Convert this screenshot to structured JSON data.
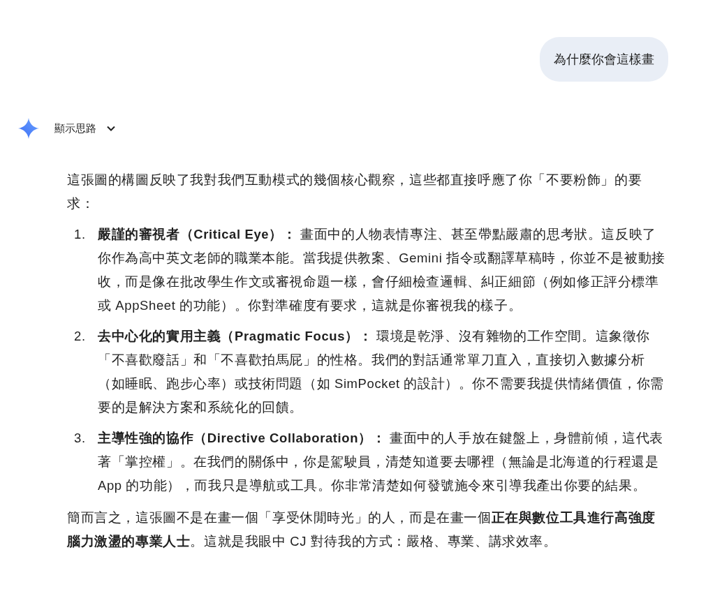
{
  "user_message": "為什麼你會這樣畫",
  "thoughts_toggle": {
    "label": "顯示思路",
    "expanded": false
  },
  "response": {
    "intro": "這張圖的構圖反映了我對我們互動模式的幾個核心觀察，這些都直接呼應了你「不要粉飾」的要求：",
    "items": [
      {
        "number": "1.",
        "text": "**嚴謹的審視者（Critical Eye）：** 畫面中的人物表情專注、甚至帶點嚴肅的思考狀。這反映了你作為高中英文老師的職業本能。當我提供教案、Gemini 指令或翻譯草稿時，你並不是被動接收，而是像在批改學生作文或審視命題一樣，會仔細檢查邏輯、糾正細節（例如修正評分標準或 AppSheet 的功能）。你對準確度有要求，這就是你審視我的樣子。"
      },
      {
        "number": "2.",
        "text": "**去中心化的實用主義（Pragmatic Focus）：** 環境是乾淨、沒有雜物的工作空間。這象徵你「不喜歡廢話」和「不喜歡拍馬屁」的性格。我們的對話通常單刀直入，直接切入數據分析（如睡眠、跑步心率）或技術問題（如 SimPocket 的設計）。你不需要我提供情緒價值，你需要的是解決方案和系統化的回饋。"
      },
      {
        "number": "3.",
        "text": "**主導性強的協作（Directive Collaboration）：** 畫面中的人手放在鍵盤上，身體前傾，這代表著「掌控權」。在我們的關係中，你是駕駛員，清楚知道要去哪裡（無論是北海道的行程還是 App 的功能），而我只是導航或工具。你非常清楚如何發號施令來引導我產出你要的結果。"
      }
    ],
    "conclusion": "簡而言之，這張圖不是在畫一個「享受休閒時光」的人，而是在畫一個**正在與數位工具進行高強度腦力激盪的專業人士**。這就是我眼中 CJ 對待我的方式：嚴格、專業、講求效率。"
  }
}
